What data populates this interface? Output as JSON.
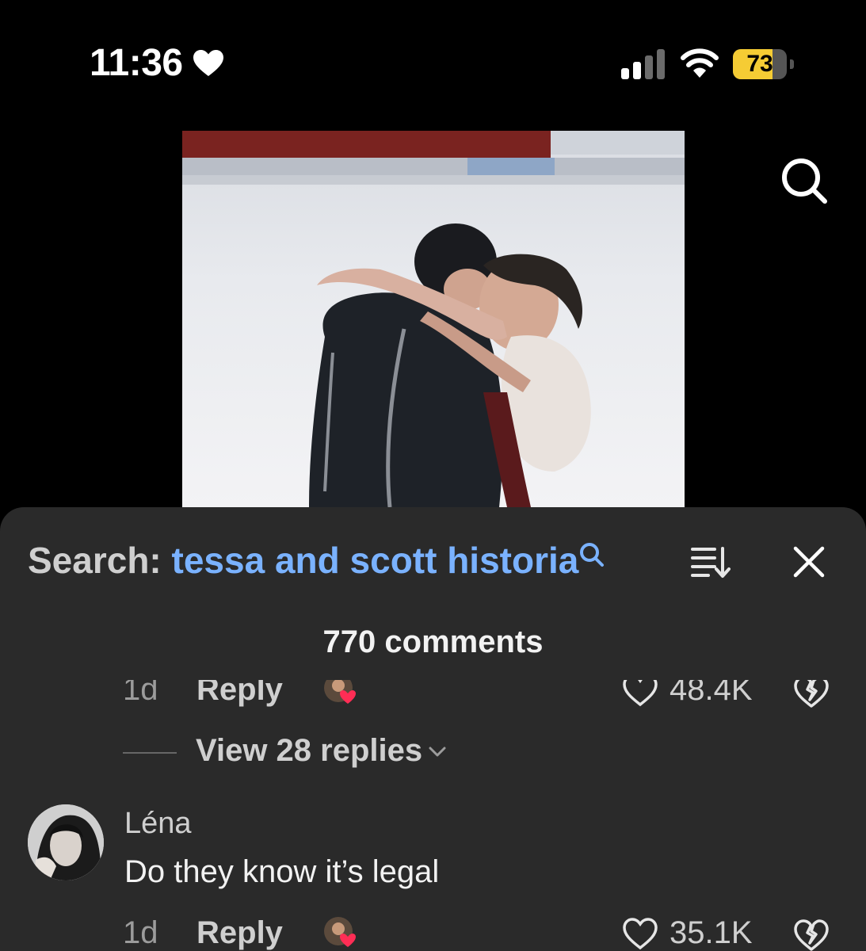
{
  "status_bar": {
    "time": "11:36",
    "battery": "73",
    "battery_level": 0.73,
    "battery_color": "#f5cc34"
  },
  "video": {
    "icon": "search-icon"
  },
  "comments_sheet": {
    "search_prefix": "Search: ",
    "search_query": "tessa and scott historia",
    "comment_count": "770 comments",
    "previous_comment": {
      "time": "1d",
      "reply_label": "Reply",
      "likes": "48.4K"
    },
    "view_replies": "View 28 replies",
    "comment": {
      "username": "Léna",
      "text": "Do they know it’s legal",
      "time": "1d",
      "reply_label": "Reply",
      "likes": "35.1K"
    }
  },
  "colors": {
    "search_query": "#7ab2ff",
    "heart_red": "#ff2d55",
    "sheet_background": "#2a2a2a"
  }
}
